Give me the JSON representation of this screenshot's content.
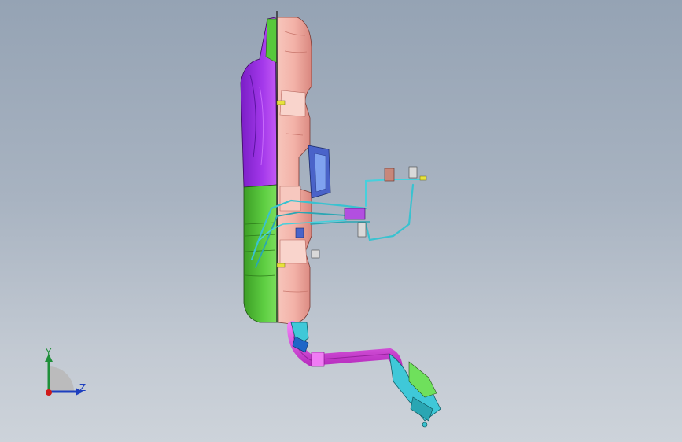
{
  "viewport": {
    "background_top": "#95a3b4",
    "background_bottom": "#cdd3da"
  },
  "model": {
    "parts": [
      {
        "name": "tank-body-right",
        "color": "#f3b2a8"
      },
      {
        "name": "tank-body-upper-left",
        "color": "#9b30e0"
      },
      {
        "name": "tank-body-lower-left",
        "color": "#57c83c"
      },
      {
        "name": "filler-hose",
        "color": "#d23fd8"
      },
      {
        "name": "fuel-lines",
        "color": "#3fc8d8"
      },
      {
        "name": "fuel-pump-flange",
        "color": "#6a9be0"
      }
    ]
  },
  "triad": {
    "y_label": "Y",
    "z_label": "Z",
    "y_color": "#1f8f3a",
    "z_color": "#1d3fbf",
    "x_color": "#d01a1a"
  }
}
